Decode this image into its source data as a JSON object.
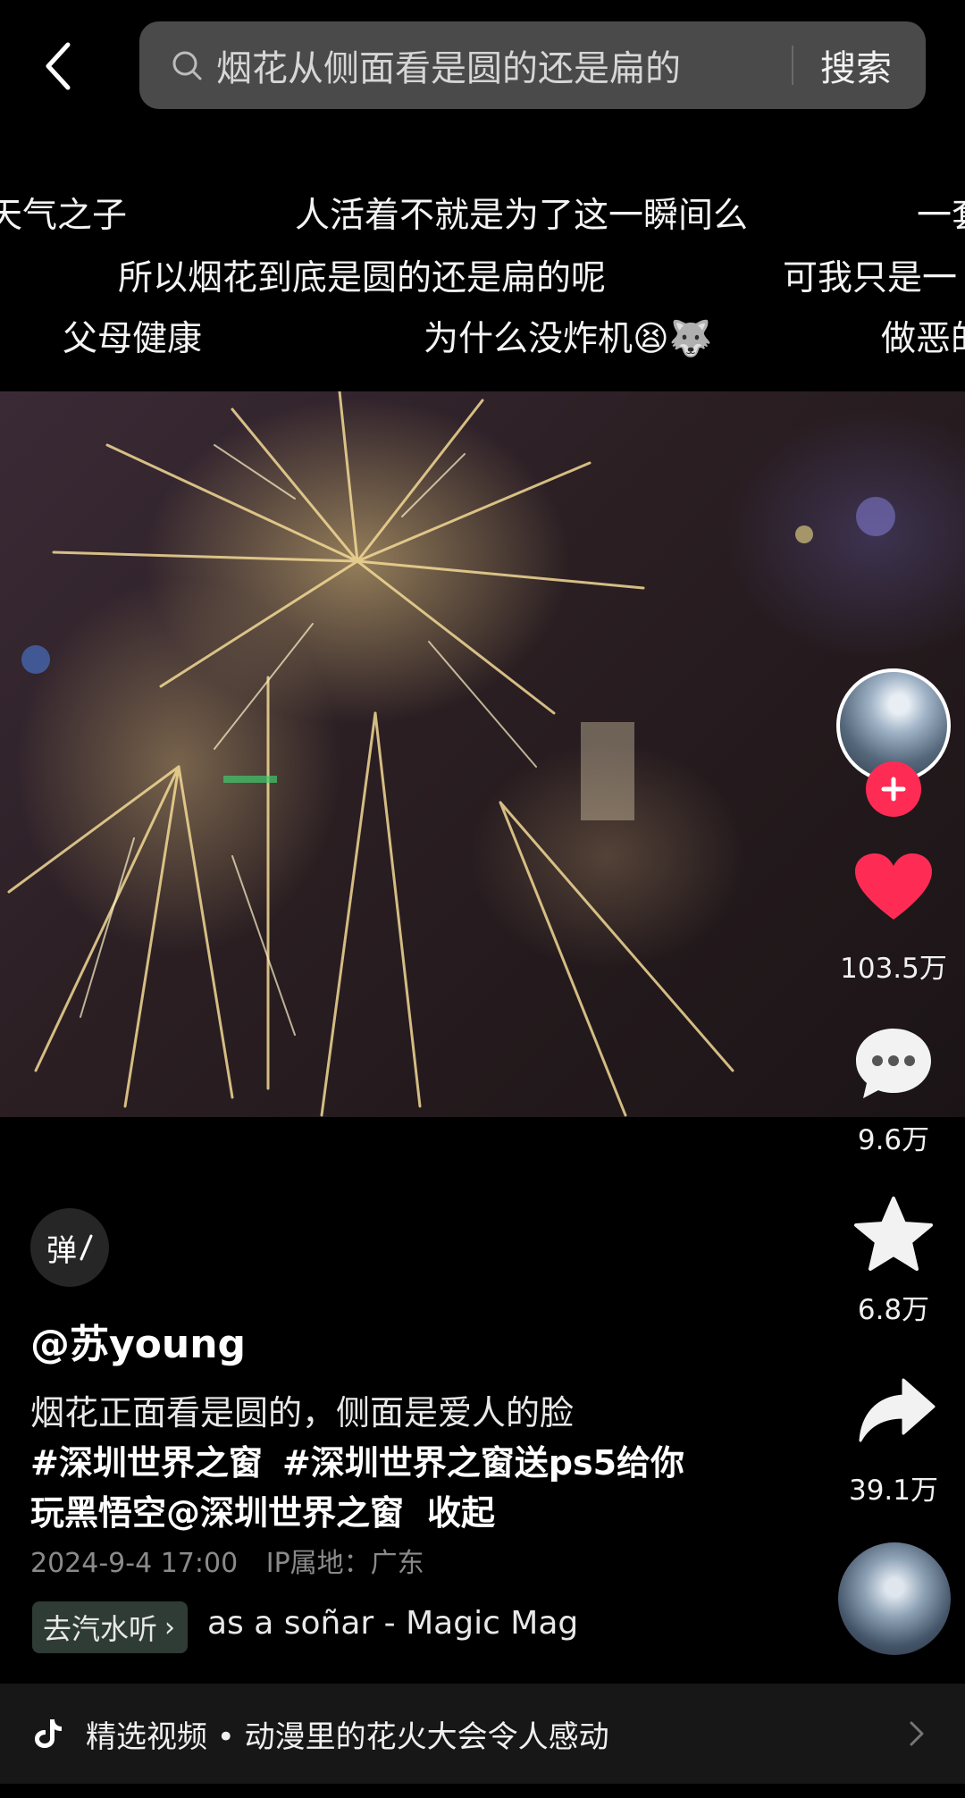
{
  "search": {
    "query": "烟花从侧面看是圆的还是扁的",
    "button_label": "搜索"
  },
  "danmaku": {
    "row1": [
      "天气之子",
      "人活着不就是为了这一瞬间么",
      "一套"
    ],
    "row2": [
      "所以烟花到底是圆的还是扁的呢",
      "可我只是一"
    ],
    "row3": [
      "父母健康",
      "为什么没炸机😫🐺",
      "做恶的"
    ]
  },
  "actions": {
    "like_count": "103.5万",
    "comment_count": "9.6万",
    "favorite_count": "6.8万",
    "share_count": "39.1万"
  },
  "colors": {
    "like": "#fe2c55",
    "follow": "#fe2c55"
  },
  "post": {
    "danmaku_toggle_label": "弹",
    "username": "@苏young",
    "desc_text": "烟花正面看是圆的，侧面是爱人的脸",
    "hashtag1": "#深圳世界之窗",
    "hashtag2": "#深圳世界之窗送ps5给你",
    "hashtag2_cont": "玩黑悟空",
    "mention": "@深圳世界之窗",
    "collapse_label": "收起",
    "date": "2024-9-4 17:00",
    "location": "IP属地：广东"
  },
  "music": {
    "button_label": "去汽水听",
    "title": "as a soñar - Magic Mag"
  },
  "bottom_bar": {
    "text": "精选视频 • 动漫里的花火大会令人感动"
  },
  "icons": [
    "back-arrow-icon",
    "search-icon",
    "plus-icon",
    "heart-icon",
    "comment-icon",
    "star-icon",
    "share-icon",
    "tiktok-logo-icon",
    "chevron-right-icon"
  ]
}
